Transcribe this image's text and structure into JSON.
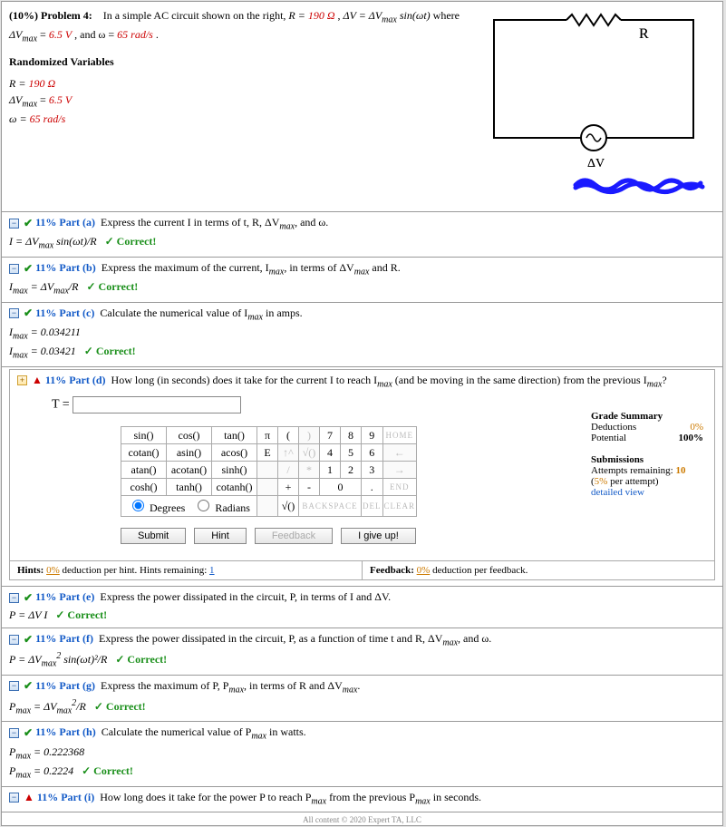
{
  "problem": {
    "header_percent": "(10%)",
    "header_label": "Problem 4:",
    "statement_text_1": "In a simple AC circuit shown on the right, ",
    "R_eq": "R = ",
    "R_val": "190 Ω",
    "comma1": ", ",
    "dV_eq": "ΔV = ΔV",
    "dV_sub": "max",
    "sin_txt": " sin(ωt)",
    "where": " where",
    "line2_pre": "ΔV",
    "line2_sub": "max",
    "line2_mid": " = ",
    "line2_val": "6.5 V",
    "line2_and": ", and ω = ",
    "omega_val": "65 rad/s",
    "line2_end": "."
  },
  "randomized_title": "Randomized Variables",
  "rv": {
    "r": {
      "lhs": "R = ",
      "val": "190 Ω"
    },
    "v": {
      "lhs_pre": "ΔV",
      "lhs_sub": "max",
      "lhs_eq": " = ",
      "val": "6.5 V"
    },
    "w": {
      "lhs": "ω = ",
      "val": "65 rad/s",
      "unit_black": ""
    }
  },
  "circuit": {
    "R_label": "R",
    "dV_label": "ΔV"
  },
  "parts": {
    "a": {
      "pct": "11% Part (a)",
      "q": "Express the current I in terms of t, R, ΔV",
      "q_sub": "max",
      "q_end": ", and ω.",
      "ans_lhs": "I = ΔV",
      "ans_sub": "max",
      "ans_rhs": " sin(ωt)/R",
      "correct": "✓ Correct!"
    },
    "b": {
      "pct": "11% Part (b)",
      "q_pre": "Express the maximum of the current, I",
      "q_sub1": "max",
      "q_mid": ", in terms of ΔV",
      "q_sub2": "max",
      "q_end": " and R.",
      "ans_lhs_pre": "I",
      "ans_lhs_sub": "max",
      "ans_mid": " = ΔV",
      "ans_sub2": "max",
      "ans_rhs": "/R",
      "correct": "✓ Correct!"
    },
    "c": {
      "pct": "11% Part (c)",
      "q_pre": "Calculate the numerical value of I",
      "q_sub": "max",
      "q_end": " in amps.",
      "ans1_pre": "I",
      "ans1_sub": "max",
      "ans1_rhs": " = 0.034211",
      "ans2_pre": "I",
      "ans2_sub": "max",
      "ans2_rhs": " = 0.03421",
      "correct": "✓ Correct!"
    },
    "d": {
      "pct": "11% Part (d)",
      "q_pre": "How long (in seconds) does it take for the current I to reach I",
      "q_sub": "max",
      "q_mid": " (and be moving in the same direction) from the previous I",
      "q_sub2": "max",
      "q_end": "?",
      "T_label": "T = "
    },
    "e": {
      "pct": "11% Part (e)",
      "q": "Express the power dissipated in the circuit, P, in terms of I and ΔV.",
      "ans": "P = ΔV I",
      "correct": "✓ Correct!"
    },
    "f": {
      "pct": "11% Part (f)",
      "q_pre": "Express the power dissipated in the circuit, P, as a function of time t and R, ΔV",
      "q_sub": "max",
      "q_end": ", and ω.",
      "ans_pre": "P = ΔV",
      "ans_sub": "max",
      "ans_sup": "2",
      "ans_rhs": " sin(ωt)²/R",
      "correct": "✓ Correct!"
    },
    "g": {
      "pct": "11% Part (g)",
      "q_pre": "Express the maximum of P, P",
      "q_sub": "max",
      "q_mid": ", in terms of R and ΔV",
      "q_sub2": "max",
      "q_end": ".",
      "ans_pre": "P",
      "ans_sub": "max",
      "ans_mid": " = ΔV",
      "ans_sub2": "max",
      "ans_sup": "2",
      "ans_rhs": "/R",
      "correct": "✓ Correct!"
    },
    "h": {
      "pct": "11% Part (h)",
      "q_pre": "Calculate the numerical value of P",
      "q_sub": "max",
      "q_end": " in watts.",
      "a1_pre": "P",
      "a1_sub": "max",
      "a1_rhs": " = 0.222368",
      "a2_pre": "P",
      "a2_sub": "max",
      "a2_rhs": " = 0.2224",
      "correct": "✓ Correct!"
    },
    "i": {
      "pct": "11% Part (i)",
      "q_pre": "How long does it take for the power P to reach P",
      "q_sub": "max",
      "q_mid": " from the previous P",
      "q_sub2": "max",
      "q_end": " in seconds."
    }
  },
  "grade": {
    "title": "Grade Summary",
    "ded_label": "Deductions",
    "ded_val": "0%",
    "pot_label": "Potential",
    "pot_val": "100%",
    "sub_title": "Submissions",
    "attempts_lbl": "Attempts remaining: ",
    "attempts_val": "10",
    "per_attempt_pre": "(",
    "per_attempt_val": "5%",
    "per_attempt_post": " per attempt)",
    "detailed": "detailed view"
  },
  "keypad": {
    "r1": [
      "sin()",
      "cos()",
      "tan()"
    ],
    "r1b": [
      "π",
      "(",
      ")",
      "7",
      "8",
      "9",
      "HOME"
    ],
    "r2": [
      "cotan()",
      "asin()",
      "acos()"
    ],
    "r2b": [
      "E",
      "↑^",
      "√()",
      "4",
      "5",
      "6",
      "←"
    ],
    "r3": [
      "atan()",
      "acotan()",
      "sinh()"
    ],
    "r3b": [
      "/",
      "*",
      "1",
      "2",
      "3",
      "→"
    ],
    "r4": [
      "cosh()",
      "tanh()",
      "cotanh()"
    ],
    "r4b": [
      "+",
      "-",
      "0",
      ".",
      "END"
    ],
    "modes_deg": "Degrees",
    "modes_rad": "Radians",
    "r5b": [
      "√()",
      "BACKSPACE",
      "DEL",
      "CLEAR"
    ]
  },
  "buttons": {
    "submit": "Submit",
    "hint": "Hint",
    "feedback": "Feedback",
    "giveup": "I give up!"
  },
  "hints": {
    "left_pre": "Hints: ",
    "left_val": "0%",
    "left_mid": " deduction per hint. Hints remaining: ",
    "left_rem": "1",
    "right_pre": "Feedback: ",
    "right_val": "0%",
    "right_end": " deduction per feedback."
  },
  "footer": "All content © 2020 Expert TA, LLC"
}
